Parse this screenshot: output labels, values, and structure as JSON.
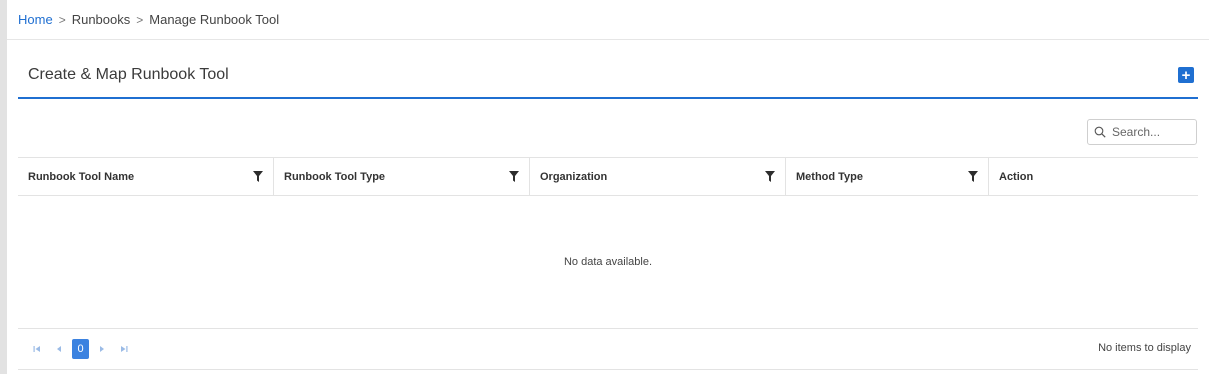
{
  "breadcrumb": {
    "home": "Home",
    "runbooks": "Runbooks",
    "current": "Manage Runbook Tool"
  },
  "card": {
    "title": "Create & Map Runbook Tool",
    "add_icon": "plus-square-icon"
  },
  "search": {
    "placeholder": "Search..."
  },
  "table": {
    "columns": [
      {
        "label": "Runbook Tool Name",
        "filter": true
      },
      {
        "label": "Runbook Tool Type",
        "filter": true
      },
      {
        "label": "Organization",
        "filter": true
      },
      {
        "label": "Method Type",
        "filter": true
      },
      {
        "label": "Action",
        "filter": false
      }
    ],
    "rows": [],
    "empty_message": "No data available."
  },
  "pager": {
    "current_page": "0",
    "info": "No items to display"
  },
  "colors": {
    "accent": "#1f6fd1",
    "page_button": "#3b82e0"
  }
}
